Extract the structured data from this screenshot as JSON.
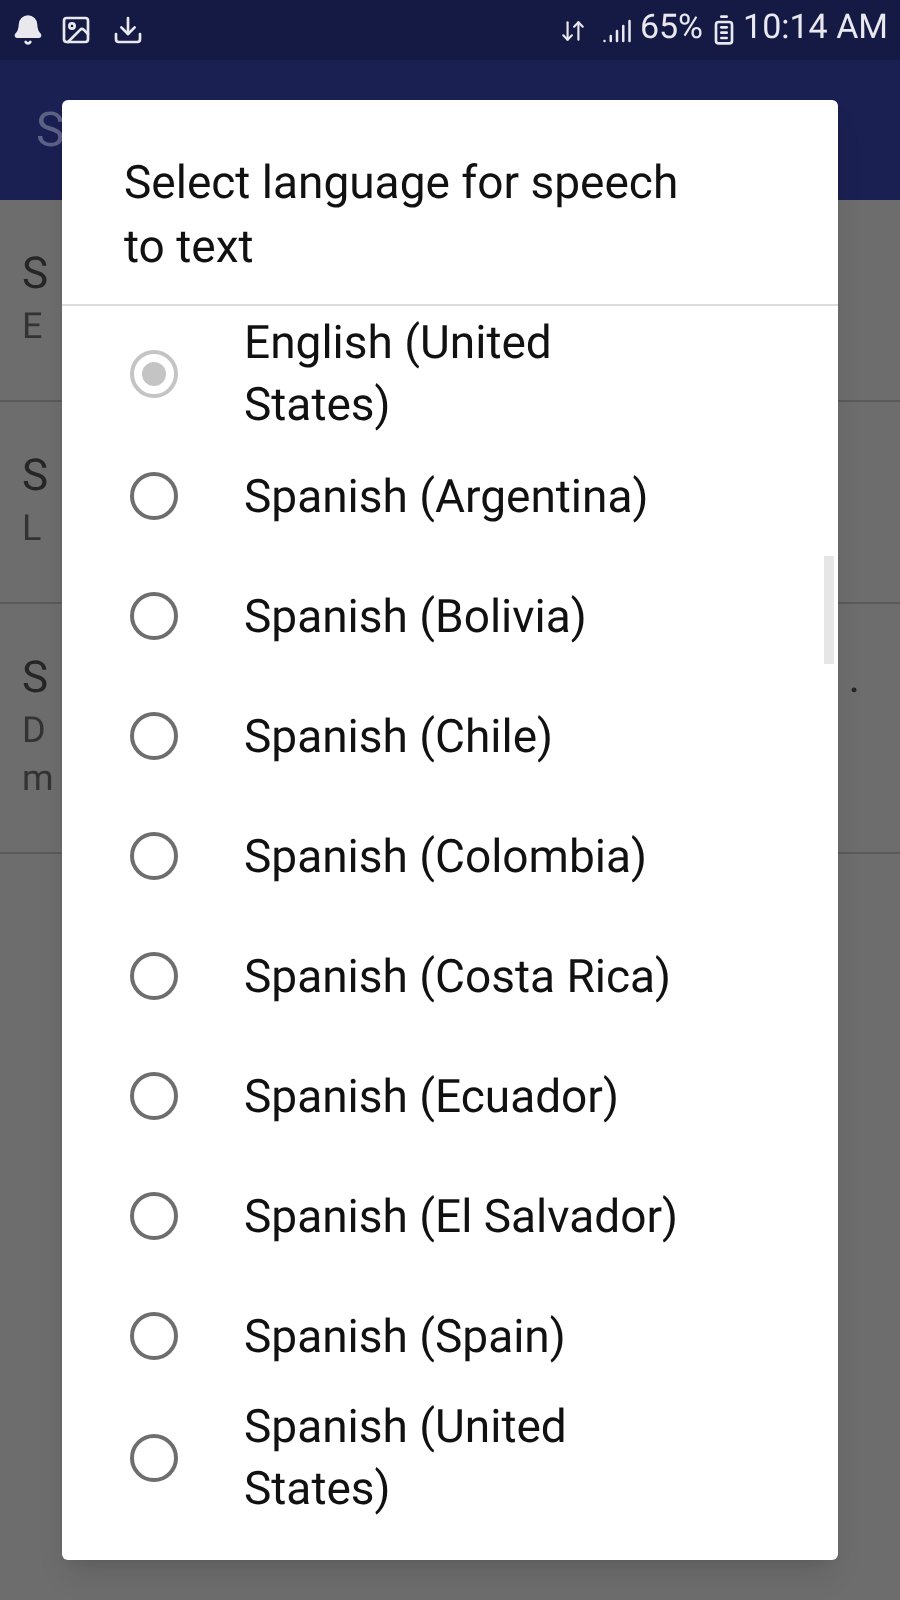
{
  "status_bar": {
    "battery": "65%",
    "time": "10:14 AM"
  },
  "app_bar": {
    "title": "S"
  },
  "background_items": [
    {
      "title": "S",
      "subtitle": [
        "E"
      ]
    },
    {
      "title": "S",
      "subtitle": [
        "L"
      ]
    },
    {
      "title": "S",
      "title_end": ".",
      "subtitle": [
        "D",
        "m"
      ]
    }
  ],
  "dialog": {
    "title": "Select language for speech to text",
    "options": [
      {
        "label": "English (United States)",
        "selected": true
      },
      {
        "label": "Spanish (Argentina)",
        "selected": false
      },
      {
        "label": "Spanish (Bolivia)",
        "selected": false
      },
      {
        "label": "Spanish (Chile)",
        "selected": false
      },
      {
        "label": "Spanish (Colombia)",
        "selected": false
      },
      {
        "label": "Spanish (Costa Rica)",
        "selected": false
      },
      {
        "label": "Spanish (Ecuador)",
        "selected": false
      },
      {
        "label": "Spanish (El Salvador)",
        "selected": false
      },
      {
        "label": "Spanish (Spain)",
        "selected": false
      },
      {
        "label": "Spanish (United States)",
        "selected": false
      }
    ]
  }
}
